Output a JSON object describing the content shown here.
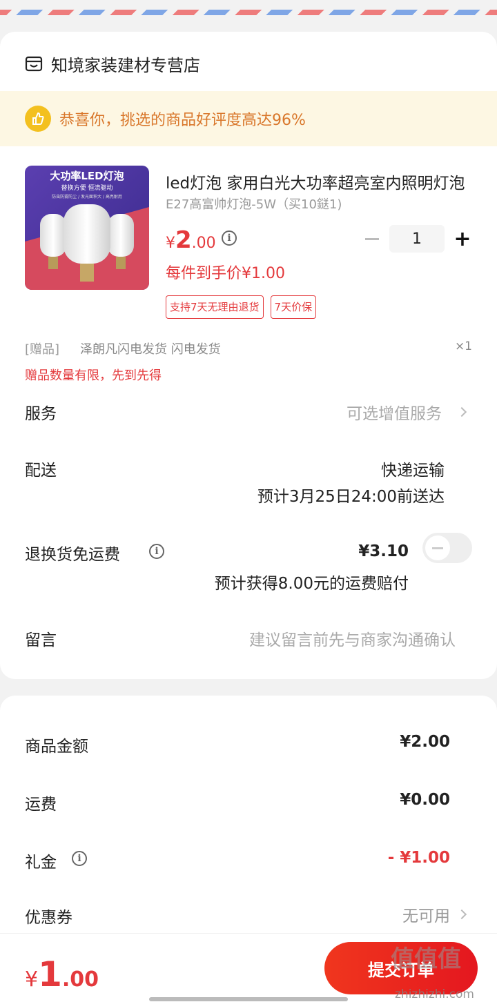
{
  "shop": {
    "name": "知境家装建材专营店",
    "icon": "store-icon"
  },
  "banner": {
    "text": "恭喜你，挑选的商品好评度高达96%",
    "icon": "thumbs-up-smile-icon",
    "color": "#f3c01f"
  },
  "product": {
    "image_title": "大功率LED灯泡",
    "image_subtitle": "替换方便 恒流驱动",
    "image_note": "防虫防雾防尘 / 发光面积大 / 高亮耐用",
    "title": "led灯泡  家用白光大功率超亮室内照明灯泡",
    "spec": "E27高富帅灯泡-5W（买10鎹1)",
    "price": {
      "currency": "¥",
      "integer": "2",
      "decimal": ".00"
    },
    "quantity": "1",
    "minus_label": "−",
    "plus_label": "+",
    "unit_price": "每件到手价¥1.00",
    "tags": [
      "支持7天无理由退货",
      "7天价保"
    ]
  },
  "gift": {
    "tag": "[赠品]",
    "name": "泽朗凡闪电发货  闪电发货",
    "qty": "×1",
    "note": "赠品数量有限，先到先得"
  },
  "rows": {
    "service": {
      "label": "服务",
      "value": "可选增值服务"
    },
    "delivery": {
      "label": "配送",
      "method": "快递运输",
      "eta": "预计3月25日24:00前送达"
    },
    "return_insurance": {
      "label": "退换货免运费",
      "price": "¥3.10",
      "note": "预计获得8.00元的运费赔付"
    },
    "message": {
      "label": "留言",
      "placeholder": "建议留言前先与商家沟通确认"
    }
  },
  "summary": {
    "goods": {
      "label": "商品金额",
      "value": "¥2.00"
    },
    "shipping": {
      "label": "运费",
      "value": "¥0.00"
    },
    "gift_cash": {
      "label": "礼金",
      "value": "- ¥1.00"
    },
    "coupon": {
      "label": "优惠券",
      "value": "无可用"
    }
  },
  "footer": {
    "total": {
      "currency": "¥",
      "integer": "1",
      "decimal": ".00"
    },
    "submit": "提交订单",
    "watermark": "值值值",
    "watermark_url": "zhizhizhi.com"
  },
  "colors": {
    "accent": "#e4393c",
    "banner_bg": "#fdf7e3",
    "banner_text": "#d9772b"
  }
}
